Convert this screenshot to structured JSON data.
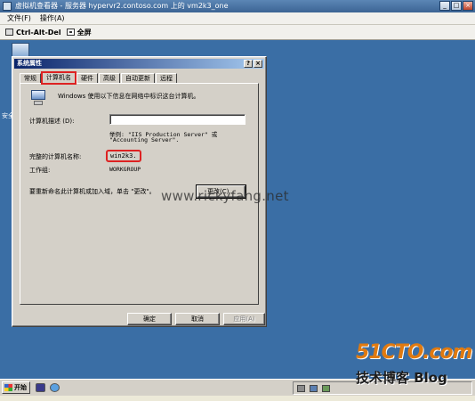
{
  "viewer": {
    "title": "虚拟机查看器 - 服务器 hypervr2.contoso.com 上的 vm2k3_one",
    "menu": [
      "文件(F)",
      "操作(A)"
    ],
    "toolbar": {
      "ctrl_alt_del": "Ctrl-Alt-Del",
      "fullscreen": "全屏"
    },
    "window_buttons": {
      "minimize": "_",
      "maximize": "□",
      "close": "×"
    }
  },
  "desktop": {
    "icon_label": "安全"
  },
  "dialog": {
    "title": "系统属性",
    "title_buttons": {
      "help": "?",
      "close": "×"
    },
    "tabs": [
      "常规",
      "计算机名",
      "硬件",
      "高级",
      "自动更新",
      "远程"
    ],
    "active_tab": "计算机名",
    "intro": "Windows 使用以下信息在网络中标识这台计算机。",
    "description_label": "计算机描述 (D):",
    "description_value": "",
    "example_line1": "举例: \"IIS Production Server\" 或",
    "example_line2": "\"Accounting Server\".",
    "full_name_label": "完整的计算机名称:",
    "full_name_value": "win2k3.",
    "workgroup_label": "工作组:",
    "workgroup_value": "WORKGROUP",
    "rename_note": "要重新命名此计算机或加入域，单击 \"更改\"。",
    "change_button": "更改(C)...",
    "ok_button": "确定",
    "cancel_button": "取消",
    "apply_button": "应用(A)"
  },
  "taskbar": {
    "start_label": "开始"
  },
  "watermarks": {
    "site": "www.rickyfang.net",
    "logo_top": "51CTO.com",
    "logo_bottom": "技术博客 Blog"
  },
  "colors": {
    "desktop": "#3a6ea5",
    "dialog_face": "#d4d0c8",
    "highlight_red": "#dd2222",
    "logo_orange": "#e07a10"
  }
}
